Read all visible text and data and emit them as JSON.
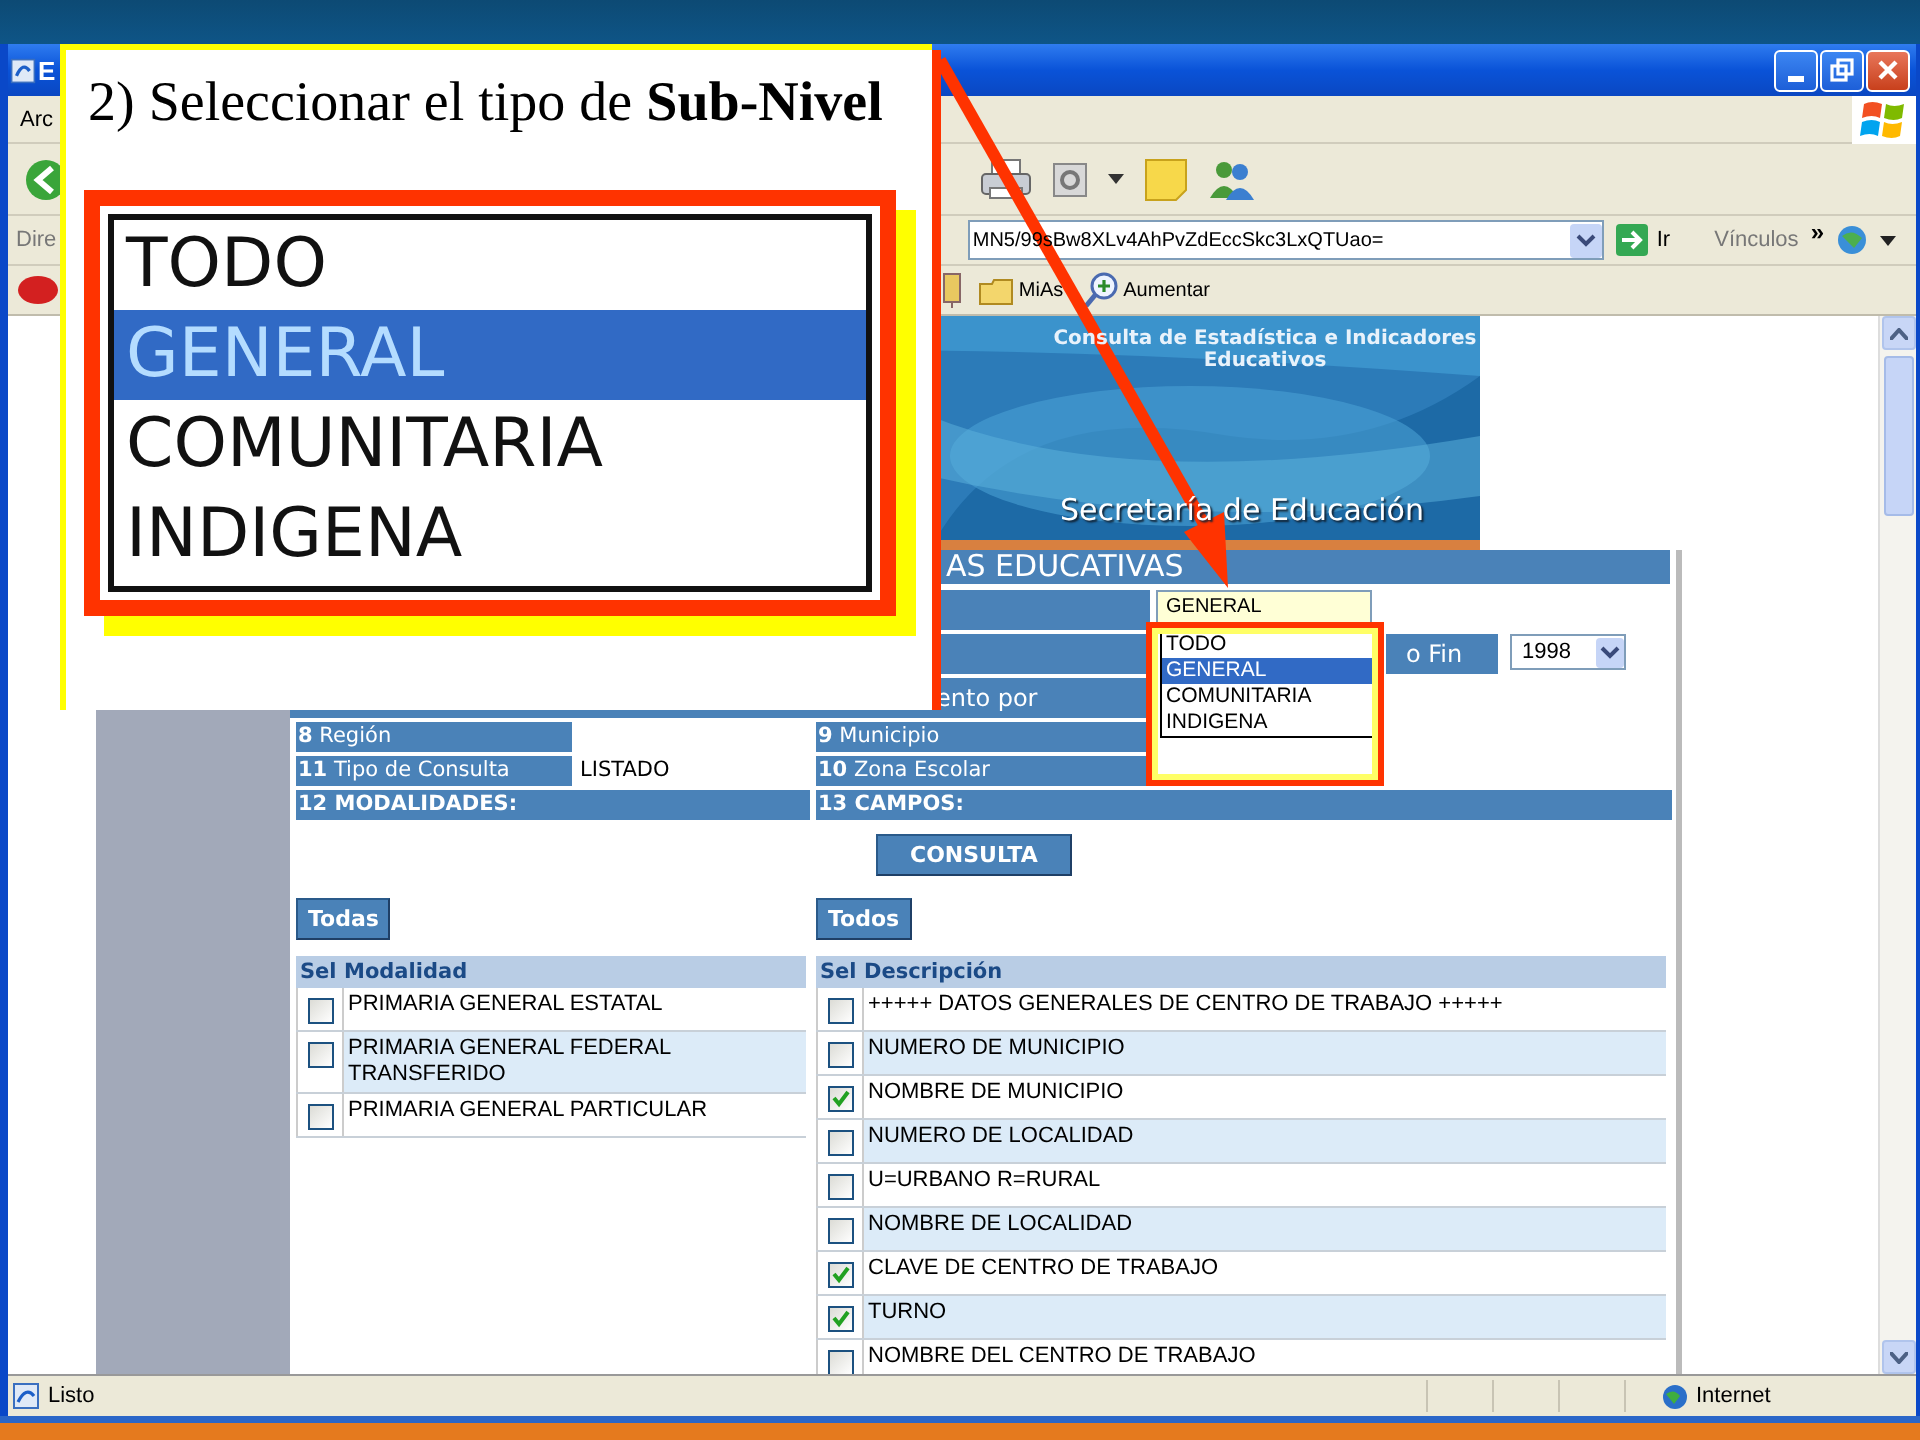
{
  "slide": {
    "instruction": "2) Seleccionar el tipo de **Sub-Nivel**",
    "zoomed_options": [
      {
        "label": "TODO",
        "selected": false
      },
      {
        "label": "GENERAL",
        "selected": true
      },
      {
        "label": "COMUNITARIA",
        "selected": false
      },
      {
        "label": "INDIGENA",
        "selected": false
      }
    ]
  },
  "window": {
    "title": "E",
    "menu": [
      "Arc"
    ],
    "address_label": "Dire",
    "address": "MN5/99sBw8XLv4AhPvZdEccSkc3LxQTUao=",
    "go": "Ir",
    "links_label": "Vínculos",
    "links_more": "»",
    "links": [
      "MiAs",
      "Aumentar"
    ]
  },
  "page": {
    "banner_title": "Consulta de Estadística e Indicadores Educativos",
    "banner_subtitle": "Secretaría de Educación",
    "section_title": "AS EDUCATIVAS",
    "subnivel_value": "GENERAL",
    "subnivel_options": [
      {
        "label": "TODO",
        "selected": false
      },
      {
        "label": "GENERAL",
        "selected": true
      },
      {
        "label": "COMUNITARIA",
        "selected": false
      },
      {
        "label": "INDIGENA",
        "selected": false
      }
    ],
    "year_end_label": "o Fin",
    "year_end": "1998",
    "grouping_label": "ento por",
    "field_rows": [
      {
        "left": {
          "number": "8",
          "label": "Región"
        },
        "right": {
          "number": "9",
          "label": "Municipio"
        }
      },
      {
        "left": {
          "number": "11",
          "label": "Tipo de Consulta",
          "value": "LISTADO"
        },
        "right": {
          "number": "10",
          "label": "Zona Escolar"
        }
      }
    ],
    "modalidades_heading": "12 MODALIDADES:",
    "campos_heading": "13 CAMPOS:",
    "consulta": "CONSULTA",
    "modalidades": {
      "button": "Todas",
      "sel_header": "Sel",
      "header": "Modalidad",
      "rows": [
        {
          "text": "PRIMARIA GENERAL ESTATAL",
          "checked": false
        },
        {
          "text": "PRIMARIA GENERAL FEDERAL TRANSFERIDO",
          "checked": false
        },
        {
          "text": "PRIMARIA GENERAL PARTICULAR",
          "checked": false
        }
      ]
    },
    "campos": {
      "button": "Todos",
      "sel_header": "Sel",
      "header": "Descripción",
      "rows": [
        {
          "text": "+++++ DATOS GENERALES DE CENTRO DE TRABAJO +++++",
          "checked": false
        },
        {
          "text": "NUMERO DE MUNICIPIO",
          "checked": false
        },
        {
          "text": "NOMBRE DE MUNICIPIO",
          "checked": true
        },
        {
          "text": "NUMERO DE LOCALIDAD",
          "checked": false
        },
        {
          "text": "U=URBANO R=RURAL",
          "checked": false
        },
        {
          "text": "NOMBRE DE LOCALIDAD",
          "checked": false
        },
        {
          "text": "CLAVE DE CENTRO DE TRABAJO",
          "checked": true
        },
        {
          "text": "TURNO",
          "checked": true
        },
        {
          "text": "NOMBRE DEL CENTRO DE TRABAJO",
          "checked": false
        }
      ]
    }
  },
  "status_bar": {
    "text": "Listo",
    "zone": "Internet"
  }
}
